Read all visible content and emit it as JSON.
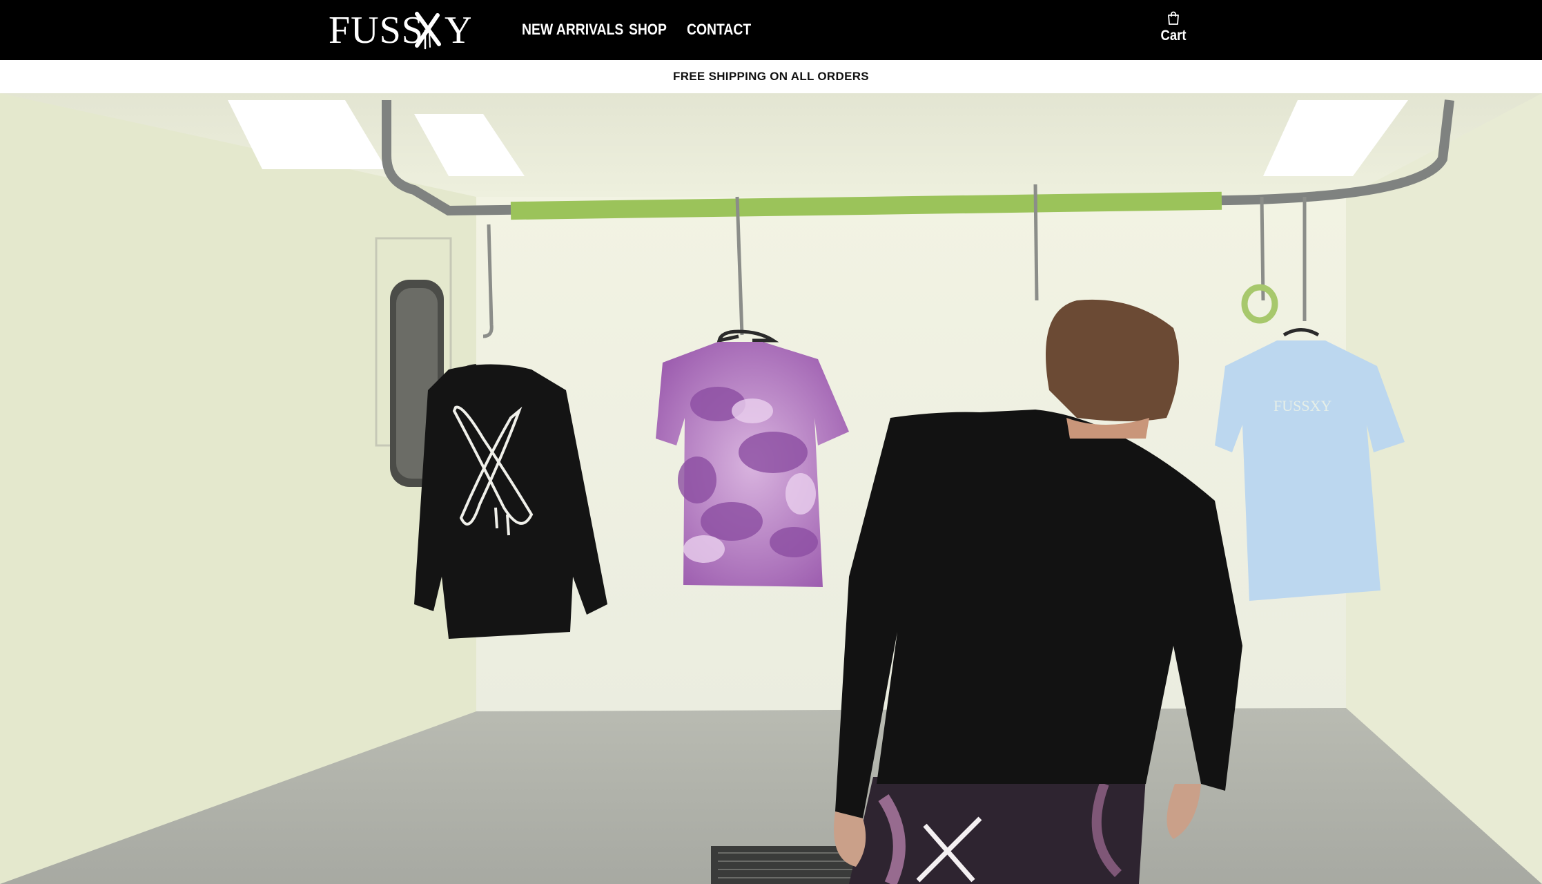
{
  "header": {
    "logo_text": "FUSSXY",
    "nav": [
      "NEW ARRIVALS",
      "SHOP",
      "CONTACT"
    ],
    "cart_label": "Cart",
    "cart_icon": "shopping-bag-icon"
  },
  "announcement": {
    "text": "FREE SHIPPING ON ALL ORDERS"
  },
  "hero": {
    "shirt_print_text": "FUSSXY"
  },
  "colors": {
    "header_bg": "#000000",
    "header_text": "#ffffff",
    "announcement_bg": "#ffffff",
    "announcement_text": "#111111",
    "tie_dye_purple": "#a86cba",
    "light_blue_tee": "#bcd7ef",
    "green_tape": "#9bc35a"
  }
}
